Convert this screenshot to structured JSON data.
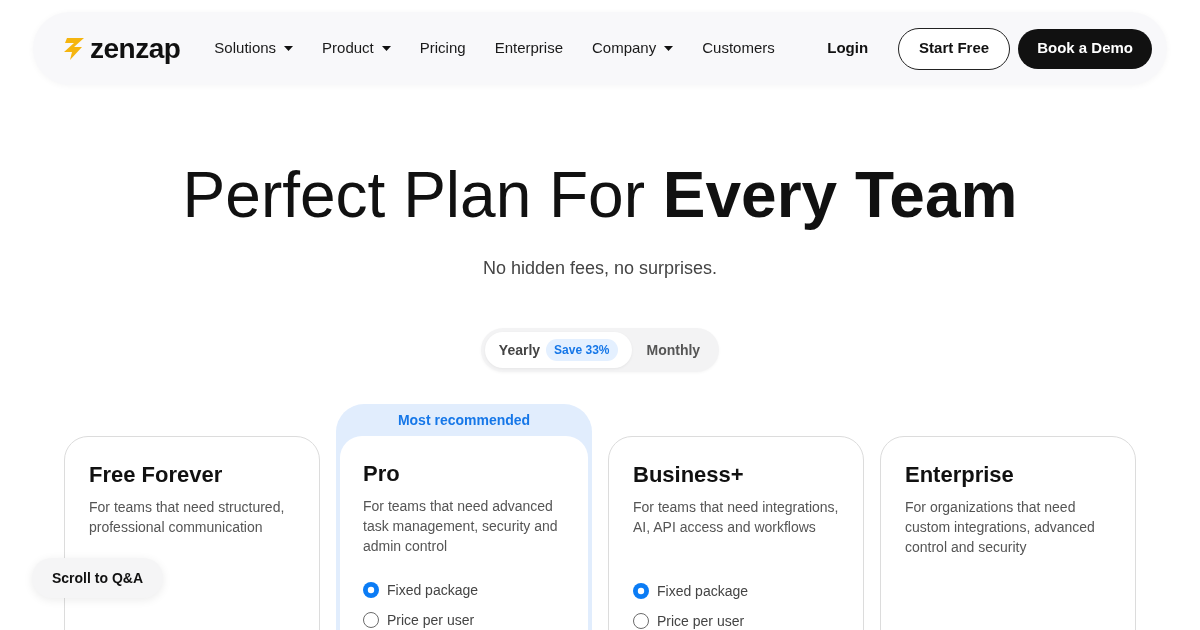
{
  "nav": {
    "logo": "zenzap",
    "items": [
      {
        "label": "Solutions",
        "dropdown": true
      },
      {
        "label": "Product",
        "dropdown": true
      },
      {
        "label": "Pricing",
        "dropdown": false
      },
      {
        "label": "Enterprise",
        "dropdown": false
      },
      {
        "label": "Company",
        "dropdown": true
      },
      {
        "label": "Customers",
        "dropdown": false
      }
    ],
    "login": "Login",
    "start_free": "Start Free",
    "book_demo": "Book a Demo"
  },
  "hero": {
    "title": "Perfect Plan For **Every Team**",
    "subtitle": "No hidden fees, no surprises."
  },
  "billing_toggle": {
    "options": [
      {
        "label": "Yearly",
        "selected": true,
        "badge": "Save 33%"
      },
      {
        "label": "Monthly",
        "selected": false
      }
    ]
  },
  "plans": [
    {
      "name": "Free Forever",
      "description": "For teams that need structured, professional communication"
    },
    {
      "name": "Pro",
      "recommended_label": "Most recommended",
      "description": "For teams that need advanced task management, security and admin control",
      "pricing_options": [
        {
          "label": "Fixed package",
          "selected": true
        },
        {
          "label": "Price per user",
          "selected": false
        }
      ]
    },
    {
      "name": "Business+",
      "description": "For teams that need integrations, AI, API access and workflows",
      "pricing_options": [
        {
          "label": "Fixed package",
          "selected": true
        },
        {
          "label": "Price per user",
          "selected": false
        }
      ]
    },
    {
      "name": "Enterprise",
      "description": "For organizations that need custom integrations, advanced control and security"
    }
  ],
  "scroll_button": "Scroll to Q&A"
}
